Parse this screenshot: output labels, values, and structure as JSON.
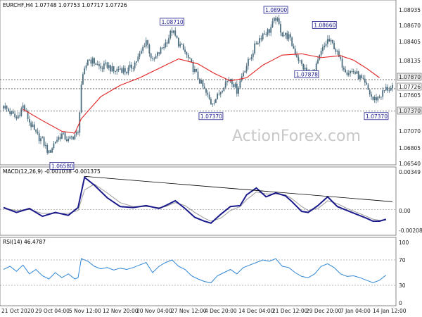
{
  "header": {
    "symbol": "EURCHF,H4",
    "ohlc": "1.07748 1.07753 1.07717 1.07726",
    "macd": "MACD(12,26,9) -0.001038 -0.001375",
    "rsi": "RSI(14) 46.4787"
  },
  "watermark": "ActionForex.com",
  "colors": {
    "candle": "#4d6e80",
    "ma": "#e02020",
    "macd": "#1a1a8c",
    "signal": "#9a9a9a",
    "rsi": "#2f86d6",
    "box": "#1a1a8c"
  },
  "chart_data": [
    {
      "type": "candlestick",
      "symbol": "EURCHF",
      "timeframe": "H4",
      "ylim": [
        1.0654,
        1.09
      ],
      "y_ticks": [
        "1.08935",
        "1.08670",
        "1.08405",
        "1.08135",
        "1.07870",
        "1.07726",
        "1.07605",
        "1.07370",
        "1.07070",
        "1.06805",
        "1.06540"
      ],
      "x_ticks": [
        "21 Oct 2020",
        "29 Oct 04:00",
        "5 Nov 12:00",
        "12 Nov 20:00",
        "20 Nov 04:00",
        "27 Nov 12:00",
        "4 Dec 20:00",
        "14 Dec 04:00",
        "21 Dec 12:00",
        "29 Dec 20:00",
        "7 Jan 04:00",
        "14 Jan 12:00"
      ],
      "close_path": [
        [
          0,
          1.0745
        ],
        [
          4,
          1.0735
        ],
        [
          8,
          1.0725
        ],
        [
          12,
          1.0745
        ],
        [
          16,
          1.072
        ],
        [
          20,
          1.07
        ],
        [
          24,
          1.069
        ],
        [
          28,
          1.067
        ],
        [
          32,
          1.069
        ],
        [
          36,
          1.07
        ],
        [
          40,
          1.069
        ],
        [
          44,
          1.07
        ],
        [
          46,
          1.07
        ],
        [
          48,
          1.078
        ],
        [
          52,
          1.082
        ],
        [
          56,
          1.0815
        ],
        [
          60,
          1.0805
        ],
        [
          64,
          1.081
        ],
        [
          68,
          1.08
        ],
        [
          72,
          1.0805
        ],
        [
          76,
          1.08
        ],
        [
          80,
          1.081
        ],
        [
          84,
          1.0825
        ],
        [
          88,
          1.085
        ],
        [
          92,
          1.0815
        ],
        [
          96,
          1.083
        ],
        [
          100,
          1.0845
        ],
        [
          104,
          1.0865
        ],
        [
          108,
          1.0845
        ],
        [
          112,
          1.083
        ],
        [
          116,
          1.081
        ],
        [
          120,
          1.079
        ],
        [
          124,
          1.077
        ],
        [
          128,
          1.075
        ],
        [
          132,
          1.076
        ],
        [
          136,
          1.078
        ],
        [
          140,
          1.079
        ],
        [
          144,
          1.077
        ],
        [
          148,
          1.08
        ],
        [
          152,
          1.082
        ],
        [
          156,
          1.0845
        ],
        [
          160,
          1.086
        ],
        [
          164,
          1.0865
        ],
        [
          168,
          1.0885
        ],
        [
          172,
          1.086
        ],
        [
          176,
          1.0855
        ],
        [
          180,
          1.083
        ],
        [
          184,
          1.081
        ],
        [
          188,
          1.0795
        ],
        [
          192,
          1.08
        ],
        [
          196,
          1.083
        ],
        [
          200,
          1.085
        ],
        [
          204,
          1.084
        ],
        [
          208,
          1.0815
        ],
        [
          212,
          1.08
        ],
        [
          216,
          1.08
        ],
        [
          220,
          1.079
        ],
        [
          224,
          1.0775
        ],
        [
          228,
          1.0755
        ],
        [
          232,
          1.076
        ],
        [
          236,
          1.07726
        ]
      ],
      "ma_path": [
        [
          12,
          1.074
        ],
        [
          24,
          1.0722
        ],
        [
          36,
          1.0705
        ],
        [
          44,
          1.0702
        ],
        [
          48,
          1.0725
        ],
        [
          60,
          1.076
        ],
        [
          72,
          1.0778
        ],
        [
          84,
          1.079
        ],
        [
          96,
          1.0805
        ],
        [
          108,
          1.082
        ],
        [
          120,
          1.0812
        ],
        [
          130,
          1.0797
        ],
        [
          140,
          1.0785
        ],
        [
          150,
          1.079
        ],
        [
          160,
          1.081
        ],
        [
          172,
          1.0826
        ],
        [
          184,
          1.0828
        ],
        [
          196,
          1.0822
        ],
        [
          208,
          1.0825
        ],
        [
          216,
          1.0818
        ],
        [
          224,
          1.0805
        ],
        [
          232,
          1.079
        ]
      ],
      "horizontal_levels": [
        1.0787,
        1.07726,
        1.0737
      ],
      "price_labels": [
        {
          "text": "1.06580",
          "x": 36,
          "y": 1.0658
        },
        {
          "text": "1.08710",
          "x": 104,
          "y": 1.0871
        },
        {
          "text": "1.08900",
          "x": 168,
          "y": 1.089
        },
        {
          "text": "1.08660",
          "x": 198,
          "y": 1.0866
        },
        {
          "text": "1.07878",
          "x": 187,
          "y": 1.07878
        },
        {
          "text": "1.07370",
          "x": 128,
          "y": 1.0737
        },
        {
          "text": "1.07370",
          "x": 230,
          "y": 1.0737
        }
      ],
      "trendline": []
    },
    {
      "type": "line",
      "title": "MACD(12,26,9)",
      "ylim": [
        -0.0025,
        0.004
      ],
      "y_ticks": [
        "0.00349",
        "0.00",
        "-0.002083"
      ],
      "series": [
        {
          "name": "MACD",
          "points": [
            [
              0,
              0.0002
            ],
            [
              8,
              -0.0003
            ],
            [
              16,
              0.0001
            ],
            [
              24,
              -0.0007
            ],
            [
              32,
              -0.0003
            ],
            [
              40,
              -0.0006
            ],
            [
              46,
              0.0002
            ],
            [
              50,
              0.0033
            ],
            [
              56,
              0.0025
            ],
            [
              64,
              0.0012
            ],
            [
              72,
              0.0003
            ],
            [
              80,
              0.0002
            ],
            [
              88,
              0.0004
            ],
            [
              96,
              0.0001
            ],
            [
              100,
              0.0004
            ],
            [
              106,
              0.0009
            ],
            [
              112,
              0.0001
            ],
            [
              118,
              -0.0008
            ],
            [
              124,
              -0.0012
            ],
            [
              128,
              -0.0014
            ],
            [
              134,
              -0.0005
            ],
            [
              140,
              0.0003
            ],
            [
              146,
              0.0004
            ],
            [
              150,
              0.0015
            ],
            [
              156,
              0.0022
            ],
            [
              162,
              0.0013
            ],
            [
              168,
              0.0017
            ],
            [
              174,
              0.0014
            ],
            [
              178,
              0.0008
            ],
            [
              184,
              -0.0002
            ],
            [
              188,
              -0.0003
            ],
            [
              194,
              0.0004
            ],
            [
              200,
              0.0013
            ],
            [
              206,
              0.0003
            ],
            [
              212,
              -0.0001
            ],
            [
              218,
              -0.0005
            ],
            [
              224,
              -0.0009
            ],
            [
              228,
              -0.0012
            ],
            [
              232,
              -0.0012
            ],
            [
              236,
              -0.001
            ]
          ]
        },
        {
          "name": "Signal",
          "points": [
            [
              0,
              0.0001
            ],
            [
              8,
              -0.0001
            ],
            [
              16,
              0.0
            ],
            [
              24,
              -0.0004
            ],
            [
              32,
              -0.0004
            ],
            [
              40,
              -0.0004
            ],
            [
              46,
              -0.0001
            ],
            [
              50,
              0.002
            ],
            [
              56,
              0.0026
            ],
            [
              64,
              0.0017
            ],
            [
              72,
              0.0007
            ],
            [
              80,
              0.0003
            ],
            [
              88,
              0.0003
            ],
            [
              96,
              0.0002
            ],
            [
              100,
              0.0003
            ],
            [
              106,
              0.0007
            ],
            [
              112,
              0.0004
            ],
            [
              118,
              -0.0003
            ],
            [
              124,
              -0.0009
            ],
            [
              128,
              -0.0012
            ],
            [
              134,
              -0.0009
            ],
            [
              140,
              -0.0001
            ],
            [
              146,
              0.0003
            ],
            [
              150,
              0.001
            ],
            [
              156,
              0.0018
            ],
            [
              162,
              0.0016
            ],
            [
              168,
              0.0016
            ],
            [
              174,
              0.0015
            ],
            [
              178,
              0.0011
            ],
            [
              184,
              0.0003
            ],
            [
              188,
              -0.0001
            ],
            [
              194,
              0.0001
            ],
            [
              200,
              0.0009
            ],
            [
              206,
              0.0006
            ],
            [
              212,
              0.0001
            ],
            [
              218,
              -0.0003
            ],
            [
              224,
              -0.0007
            ],
            [
              228,
              -0.001
            ],
            [
              232,
              -0.0011
            ],
            [
              236,
              -0.0011
            ]
          ]
        }
      ],
      "trendline": [
        [
          50,
          0.0034
        ],
        [
          240,
          0.0008
        ]
      ]
    },
    {
      "type": "line",
      "title": "RSI(14)",
      "ylim": [
        0,
        100
      ],
      "y_ticks": [
        "100",
        "70",
        "30",
        "0"
      ],
      "guides": [
        70,
        30
      ],
      "series": [
        {
          "name": "RSI",
          "points": [
            [
              0,
              55
            ],
            [
              4,
              60
            ],
            [
              8,
              52
            ],
            [
              12,
              62
            ],
            [
              16,
              48
            ],
            [
              20,
              55
            ],
            [
              24,
              45
            ],
            [
              28,
              40
            ],
            [
              32,
              50
            ],
            [
              36,
              42
            ],
            [
              40,
              48
            ],
            [
              44,
              40
            ],
            [
              46,
              42
            ],
            [
              48,
              72
            ],
            [
              52,
              68
            ],
            [
              56,
              60
            ],
            [
              60,
              56
            ],
            [
              64,
              58
            ],
            [
              68,
              54
            ],
            [
              72,
              57
            ],
            [
              76,
              55
            ],
            [
              80,
              58
            ],
            [
              84,
              62
            ],
            [
              88,
              66
            ],
            [
              92,
              50
            ],
            [
              96,
              60
            ],
            [
              100,
              66
            ],
            [
              104,
              70
            ],
            [
              108,
              60
            ],
            [
              112,
              55
            ],
            [
              116,
              45
            ],
            [
              120,
              40
            ],
            [
              124,
              36
            ],
            [
              128,
              34
            ],
            [
              132,
              45
            ],
            [
              136,
              50
            ],
            [
              140,
              55
            ],
            [
              144,
              48
            ],
            [
              148,
              58
            ],
            [
              152,
              62
            ],
            [
              156,
              66
            ],
            [
              160,
              70
            ],
            [
              164,
              68
            ],
            [
              168,
              72
            ],
            [
              172,
              60
            ],
            [
              176,
              58
            ],
            [
              180,
              50
            ],
            [
              184,
              44
            ],
            [
              188,
              42
            ],
            [
              192,
              48
            ],
            [
              196,
              60
            ],
            [
              200,
              64
            ],
            [
              204,
              58
            ],
            [
              208,
              48
            ],
            [
              212,
              44
            ],
            [
              216,
              45
            ],
            [
              220,
              42
            ],
            [
              224,
              38
            ],
            [
              228,
              34
            ],
            [
              232,
              38
            ],
            [
              236,
              46
            ]
          ]
        }
      ]
    }
  ]
}
